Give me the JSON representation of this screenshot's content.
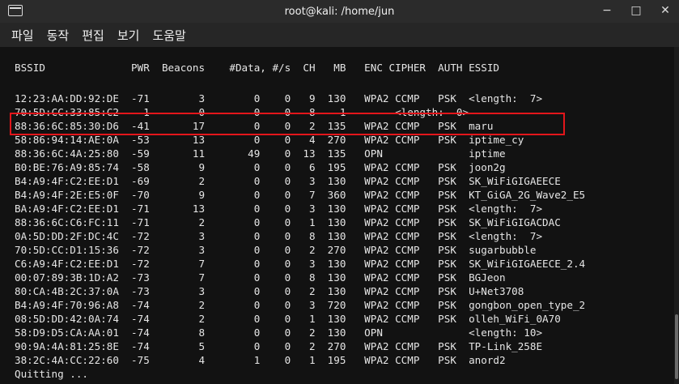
{
  "window": {
    "title": "root@kali: /home/jun",
    "buttons": {
      "minimize": "−",
      "maximize": "□",
      "close": "✕"
    }
  },
  "menu": [
    "파일",
    "동작",
    "편집",
    "보기",
    "도움말"
  ],
  "table": {
    "header": "BSSID              PWR  Beacons    #Data, #/s  CH   MB   ENC CIPHER  AUTH ESSID",
    "rows": [
      "12:23:AA:DD:92:DE  -71        3        0    0   9  130   WPA2 CCMP   PSK  <length:  7>",
      "70:5D:CC:33:85:C2   -1        0        0    0   8   -1        <length:  0>",
      "88:36:6C:85:30:D6  -41       17        0    0   2  135   WPA2 CCMP   PSK  maru",
      "58:86:94:14:AE:0A  -53       13        0    0   4  270   WPA2 CCMP   PSK  iptime_cy",
      "88:36:6C:4A:25:80  -59       11       49    0  13  135   OPN              iptime",
      "B0:BE:76:A9:85:74  -58        9        0    0   6  195   WPA2 CCMP   PSK  joon2g",
      "B4:A9:4F:C2:EE:D1  -69        2        0    0   3  130   WPA2 CCMP   PSK  SK_WiFiGIGAEECE",
      "B4:A9:4F:2E:E5:0F  -70        9        0    0   7  360   WPA2 CCMP   PSK  KT_GiGA_2G_Wave2_E5",
      "BA:A9:4F:C2:EE:D1  -71       13        0    0   3  130   WPA2 CCMP   PSK  <length:  7>",
      "88:36:6C:C6:FC:11  -71        2        0    0   1  130   WPA2 CCMP   PSK  SK_WiFiGIGACDAC",
      "0A:5D:DD:2F:DC:4C  -72        3        0    0   8  130   WPA2 CCMP   PSK  <length:  7>",
      "70:5D:CC:D1:15:36  -72        3        0    0   2  270   WPA2 CCMP   PSK  sugarbubble",
      "C6:A9:4F:C2:EE:D1  -72        7        0    0   3  130   WPA2 CCMP   PSK  SK_WiFiGIGAEECE_2.4",
      "00:07:89:3B:1D:A2  -73        7        0    0   8  130   WPA2 CCMP   PSK  BGJeon",
      "80:CA:4B:2C:37:0A  -73        3        0    0   2  130   WPA2 CCMP   PSK  U+Net3708",
      "B4:A9:4F:70:96:A8  -74        2        0    0   3  720   WPA2 CCMP   PSK  gongbon_open_type_2",
      "08:5D:DD:42:0A:74  -74        2        0    0   1  130   WPA2 CCMP   PSK  olleh_WiFi_0A70",
      "58:D9:D5:CA:AA:01  -74        8        0    0   2  130   OPN              <length: 10>",
      "90:9A:4A:81:25:8E  -74        5        0    0   2  270   WPA2 CCMP   PSK  TP-Link_258E",
      "38:2C:4A:CC:22:60  -75        4        1    0   1  195   WPA2 CCMP   PSK  anord2"
    ]
  },
  "footer": "Quitting ...",
  "colors": {
    "highlight": "#e3161b",
    "text": "#e6e6e6",
    "background": "#121212"
  }
}
